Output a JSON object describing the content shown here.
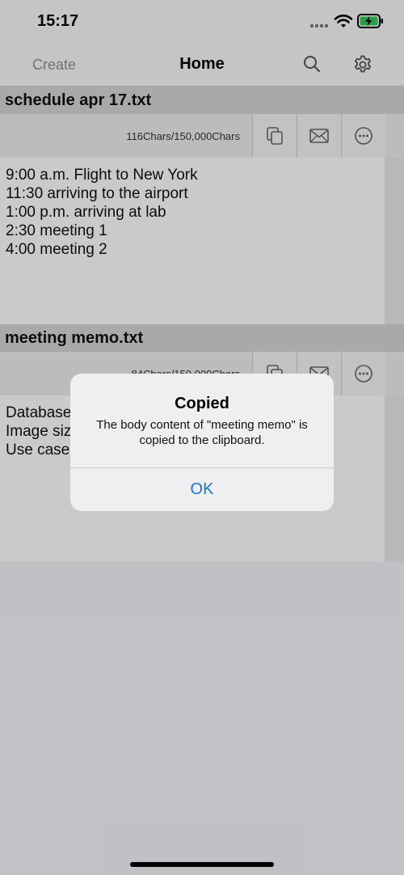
{
  "status_bar": {
    "time": "15:17"
  },
  "nav": {
    "create_label": "Create",
    "title": "Home",
    "search_icon": "search-icon",
    "settings_icon": "gear-icon"
  },
  "notes": [
    {
      "title": "schedule apr 17.txt",
      "char_count": "116Chars/150,000Chars",
      "lines": [
        "9:00 a.m. Flight to New York",
        "11:30 arriving to the airport",
        "1:00 p.m. arriving at lab",
        "2:30 meeting 1",
        "4:00 meeting 2"
      ]
    },
    {
      "title": "meeting memo.txt",
      "char_count": "84Chars/150,000Chars",
      "lines": [
        "Database",
        "Image siz",
        "Use case"
      ]
    }
  ],
  "toolbar_icons": [
    "copy-icon",
    "mail-icon",
    "more-icon"
  ],
  "alert": {
    "title": "Copied",
    "message": "The body content of \"meeting memo\" is copied to the clipboard.",
    "ok_label": "OK"
  },
  "colors": {
    "accent": "#1a74d2",
    "battery": "#34c759"
  }
}
